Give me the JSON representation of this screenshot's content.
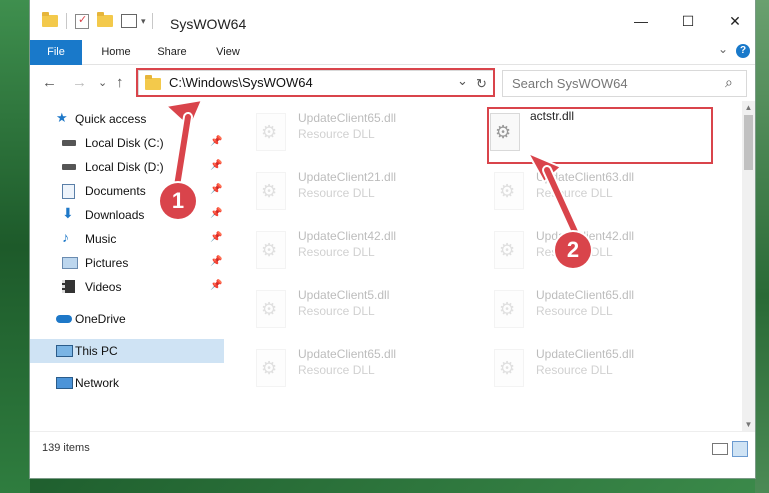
{
  "window": {
    "title": "SysWOW64",
    "controls": {
      "minimize": "—",
      "maximize": "☐",
      "close": "✕"
    }
  },
  "ribbon": {
    "tabs": [
      "File",
      "Home",
      "Share",
      "View"
    ],
    "expand": "⌄",
    "help": "?"
  },
  "nav": {
    "back": "←",
    "forward": "→",
    "recent": "⌄",
    "up": "↑",
    "address": "C:\\Windows\\SysWOW64",
    "address_dropdown": "⌄",
    "refresh": "↻",
    "search_placeholder": "Search SysWOW64",
    "search_icon": "⌕"
  },
  "sidebar": {
    "items": [
      {
        "label": "Quick access",
        "icon": "star-icon",
        "pinned": false,
        "top": true
      },
      {
        "label": "Local Disk (C:)",
        "icon": "drive-icon",
        "pinned": true
      },
      {
        "label": "Local Disk (D:)",
        "icon": "drive-icon",
        "pinned": true
      },
      {
        "label": "Documents",
        "icon": "documents-icon",
        "pinned": true
      },
      {
        "label": "Downloads",
        "icon": "download-icon",
        "pinned": true
      },
      {
        "label": "Music",
        "icon": "music-icon",
        "pinned": true
      },
      {
        "label": "Pictures",
        "icon": "pictures-icon",
        "pinned": true
      },
      {
        "label": "Videos",
        "icon": "videos-icon",
        "pinned": true
      },
      {
        "label": "OneDrive",
        "icon": "cloud-icon",
        "pinned": false,
        "top": true
      },
      {
        "label": "This PC",
        "icon": "computer-icon",
        "pinned": false,
        "top": true,
        "selected": true
      },
      {
        "label": "Network",
        "icon": "network-icon",
        "pinned": false,
        "top": true
      }
    ],
    "pin_glyph": "📌"
  },
  "files": {
    "left": [
      {
        "name": "UpdateClient65.dll",
        "type": "Resource DLL"
      },
      {
        "name": "UpdateClient21.dll",
        "type": "Resource DLL"
      },
      {
        "name": "UpdateClient42.dll",
        "type": "Resource DLL"
      },
      {
        "name": "UpdateClient5.dll",
        "type": "Resource DLL"
      },
      {
        "name": "UpdateClient65.dll",
        "type": "Resource DLL"
      }
    ],
    "right": [
      {
        "name": "actstr.dll",
        "type": ""
      },
      {
        "name": "UpdateClient63.dll",
        "type": "Resource DLL"
      },
      {
        "name": "UpdateClient42.dll",
        "type": "Resource DLL"
      },
      {
        "name": "UpdateClient65.dll",
        "type": "Resource DLL"
      },
      {
        "name": "UpdateClient65.dll",
        "type": "Resource DLL"
      }
    ]
  },
  "status": {
    "count": "139 items"
  },
  "annotations": {
    "badge1": "1",
    "badge2": "2",
    "color": "#d9444b"
  }
}
